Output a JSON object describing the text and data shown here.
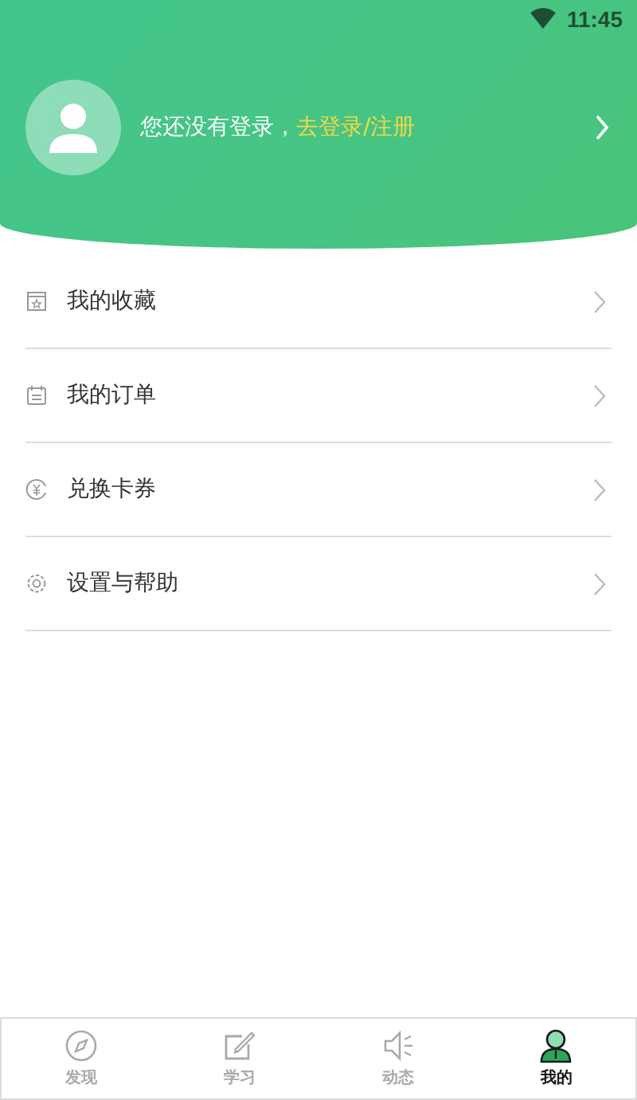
{
  "status_bar": {
    "time": "11:45"
  },
  "profile": {
    "prompt": "您还没有登录，",
    "login_link": "去登录/注册"
  },
  "menu": [
    {
      "label": "我的收藏"
    },
    {
      "label": "我的订单"
    },
    {
      "label": "兑换卡券"
    },
    {
      "label": "设置与帮助"
    }
  ],
  "tab_bar": [
    {
      "label": "发现",
      "selected": false
    },
    {
      "label": "学习",
      "selected": false
    },
    {
      "label": "动态",
      "selected": false
    },
    {
      "label": "我的",
      "selected": true
    }
  ]
}
